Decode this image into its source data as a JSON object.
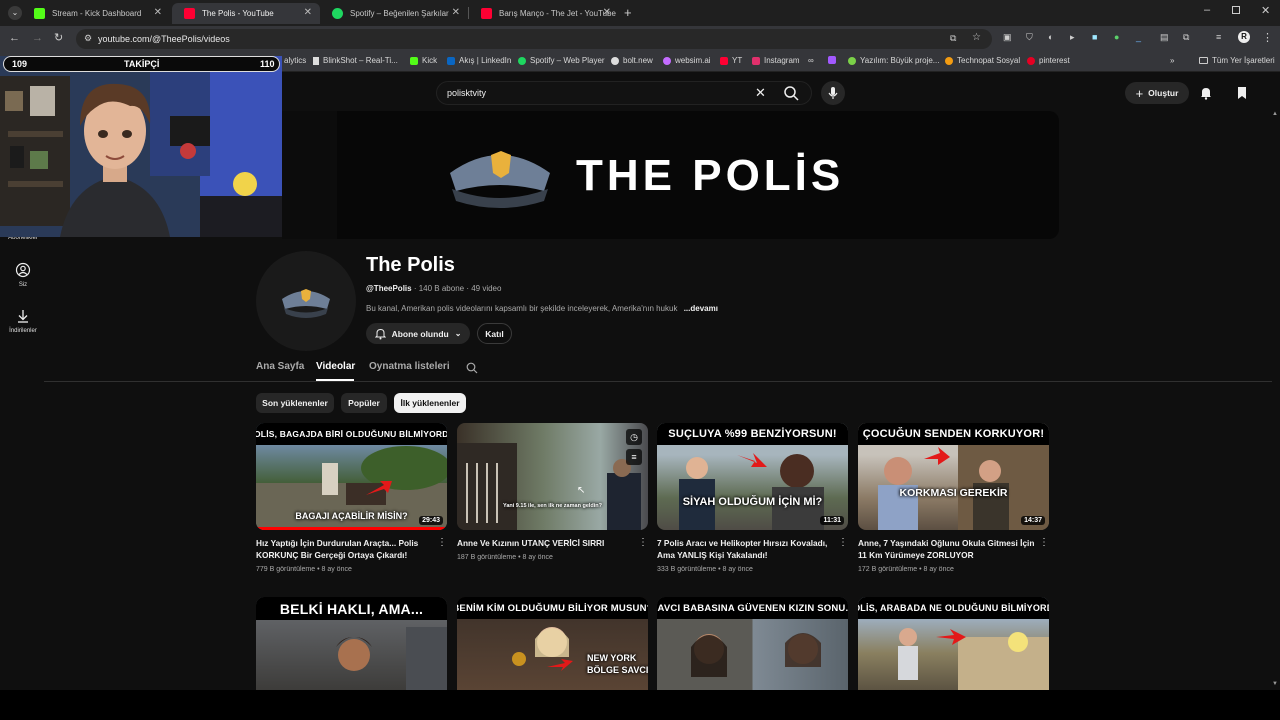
{
  "browser": {
    "tabs": [
      {
        "title": "Stream - Kick Dashboard",
        "fav_color": "#53fc18"
      },
      {
        "title": "The Polis - YouTube",
        "fav_color": "#ff0033"
      },
      {
        "title": "Spotify – Beğenilen Şarkılar",
        "fav_color": "#1ed760"
      },
      {
        "title": "Barış Manço - The Jet - YouTube",
        "fav_color": "#ff0033"
      }
    ],
    "url": "youtube.com/@TheePolis/videos",
    "bookmarks": [
      {
        "label": "alytics",
        "color": "#888"
      },
      {
        "label": "BlinkShot – Real-Ti...",
        "color": "#ddd"
      },
      {
        "label": "Kick",
        "color": "#53fc18"
      },
      {
        "label": "Akış | LinkedIn",
        "color": "#0a66c2"
      },
      {
        "label": "Spotify – Web Player",
        "color": "#1ed760"
      },
      {
        "label": "bolt.new",
        "color": "#ddd"
      },
      {
        "label": "websim.ai",
        "color": "#c46cff"
      },
      {
        "label": "YT",
        "color": "#ff0033"
      },
      {
        "label": "Instagram",
        "color": "#e1306c"
      },
      {
        "label": "Yazılım: Büyük proje...",
        "color": "#7bd148"
      },
      {
        "label": "Technopat Sosyal",
        "color": "#f39c12"
      },
      {
        "label": "pinterest",
        "color": "#e60023"
      }
    ],
    "all_bookmarks": "Tüm Yer İşaretleri"
  },
  "overlay": {
    "followers_left": "109",
    "followers_label": "TAKİPÇİ",
    "followers_right": "110"
  },
  "youtube": {
    "search_value": "polisktvity",
    "create_label": "Oluştur",
    "sidebar": [
      {
        "label": "Abonelikler"
      },
      {
        "label": "Siz"
      },
      {
        "label": "İndirilenler"
      }
    ],
    "banner_text": "THE POLİS",
    "channel": {
      "name": "The Polis",
      "handle": "@TheePolis",
      "stats": "· 140 B abone · 49 video",
      "description": "Bu kanal, Amerikan polis videolarını kapsamlı bir şekilde inceleyerek, Amerika'nın hukuk",
      "more": "...devamı",
      "subscribed_label": "Abone olundu",
      "join_label": "Katıl"
    },
    "tabs": [
      "Ana Sayfa",
      "Videolar",
      "Oynatma listeleri"
    ],
    "active_tab": "Videolar",
    "chips": [
      "Son yüklenenler",
      "Popüler",
      "İlk yüklenenler"
    ],
    "active_chip": "İlk yüklenenler",
    "videos": [
      {
        "caption": "POLİS, BAGAJDA BİRİ OLDUĞUNU BİLMİYORDU",
        "overlay": "BAGAJI AÇABİLİR MİSİN?",
        "duration": "29:43",
        "title": "Hız Yaptığı İçin Durdurulan Araçta... Polis KORKUNÇ Bir Gerçeği Ortaya Çıkardı!",
        "views": "779 B görüntüleme",
        "age": "8 ay önce",
        "progress": 1.0
      },
      {
        "caption": "",
        "overlay": "Yani 9.15 ile, sen ilk ne zaman geldin?",
        "duration": "",
        "title": "Anne Ve Kızının UTANÇ VERİCİ SIRRI",
        "views": "187 B görüntüleme",
        "age": "8 ay önce",
        "progress": 0
      },
      {
        "caption": "SUÇLUYA %99 BENZİYORSUN!",
        "overlay": "SİYAH OLDUĞUM İÇİN Mİ?",
        "duration": "11:31",
        "title": "7 Polis Aracı ve Helikopter Hırsızı Kovaladı, Ama YANLIŞ Kişi Yakalandı!",
        "views": "333 B görüntüleme",
        "age": "8 ay önce",
        "progress": 0
      },
      {
        "caption": "ÇOCUĞUN SENDEN KORKUYOR!",
        "overlay": "KORKMASI GEREKİR",
        "duration": "14:37",
        "title": "Anne, 7 Yaşındaki Oğlunu Okula Gitmesi İçin 11 Km Yürümeye ZORLUYOR",
        "views": "172 B görüntüleme",
        "age": "8 ay önce",
        "progress": 0
      },
      {
        "caption": "BELKİ HAKLI, AMA...",
        "overlay": ""
      },
      {
        "caption": "BENİM KİM OLDUĞUMU BİLİYOR MUSUN?",
        "overlay": "NEW YORK BÖLGE SAVCISI"
      },
      {
        "caption": "SAVCI BABASINA GÜVENEN KIZIN SONU...",
        "overlay": ""
      },
      {
        "caption": "POLİS, ARABADA NE OLDUĞUNU BİLMİYORDU",
        "overlay": ""
      }
    ]
  }
}
